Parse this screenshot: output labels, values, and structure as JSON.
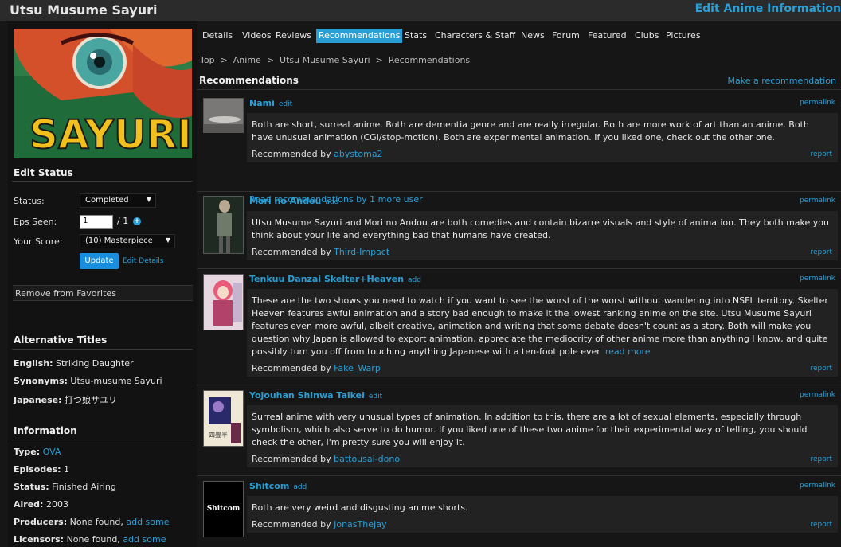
{
  "header": {
    "title": "Utsu Musume Sayuri",
    "edit_info": "Edit Anime Information"
  },
  "sidebar": {
    "poster_text": "SAYURI",
    "edit_status_heading": "Edit Status",
    "status_label": "Status:",
    "status_value": "Completed",
    "eps_label": "Eps Seen:",
    "eps_value": "1",
    "eps_total": "/ 1",
    "score_label": "Your Score:",
    "score_value": "(10) Masterpiece",
    "update_label": "Update",
    "edit_details_label": "Edit Details",
    "remove_favorites": "Remove from Favorites",
    "alt_titles_heading": "Alternative Titles",
    "english_label": "English:",
    "english_value": "Striking Daughter",
    "synonyms_label": "Synonyms:",
    "synonyms_value": "Utsu-musume Sayuri",
    "japanese_label": "Japanese:",
    "japanese_value": "打つ娘サユリ",
    "information_heading": "Information",
    "type_label": "Type:",
    "type_value": "OVA",
    "episodes_label": "Episodes:",
    "episodes_value": "1",
    "status2_label": "Status:",
    "status2_value": "Finished Airing",
    "aired_label": "Aired:",
    "aired_value": "2003",
    "producers_label": "Producers:",
    "producers_value": "None found,",
    "producers_add": "add some",
    "licensors_label": "Licensors:",
    "licensors_value": "None found,",
    "licensors_add": "add some"
  },
  "tabs": [
    "Details",
    "Videos",
    "Reviews",
    "Recommendations",
    "Stats",
    "Characters & Staff",
    "News",
    "Forum",
    "Featured",
    "Clubs",
    "Pictures"
  ],
  "active_tab": "Recommendations",
  "breadcrumb": [
    "Top",
    "Anime",
    "Utsu Musume Sayuri",
    "Recommendations"
  ],
  "breadcrumb_sep": ">",
  "recommendations_heading": "Recommendations",
  "make_recommendation": "Make a recommendation",
  "permalink_label": "permalink",
  "report_label": "report",
  "recommended_by_label": "Recommended by",
  "read_more_users": "Read recommendations by 1 more user",
  "recs": [
    {
      "title": "Nami",
      "action": "edit",
      "text": "Both are short, surreal anime. Both are dementia genre and are really irregular. Both are more work of art than an anime. Both have unusual animation (CGI/stop-motion). Both are experimental animation. If you liked one, check out the other one.",
      "user": "abystoma2"
    },
    {
      "title": "Mori no Andou",
      "action": "add",
      "text": "Utsu Musume Sayuri and Mori no Andou are both comedies and contain bizarre visuals and style of animation. They both make you think about your life and everything bad that humans have created.",
      "user": "Third-Impact"
    },
    {
      "title": "Tenkuu Danzai Skelter+Heaven",
      "action": "add",
      "text": "These are the two shows you need to watch if you want to see the worst of the worst without wandering into NSFL territory. Skelter Heaven features awful animation and a story bad enough to make it the lowest ranking anime on the site. Utsu Musume Sayuri features even more awful, albeit creative, animation and writing that some debate doesn't count as a story. Both will make you question why Japan is allowed to export animation, appreciate the mediocrity of other anime more than anything I know, and quite possibly turn you off from touching anything Japanese with a ten-foot pole ever",
      "more": "read more",
      "user": "Fake_Warp"
    },
    {
      "title": "Yojouhan Shinwa Taikei",
      "action": "edit",
      "text": "Surreal anime with very unusual types of animation. In addition to this, there are a lot of sexual elements, especially through symbolism, which also serve to do humor. If you liked one of these two anime for their experimental way of telling, you should check the other, I'm pretty sure you will enjoy it.",
      "user": "battousai-dono"
    },
    {
      "title": "Shitcom",
      "action": "add",
      "thumb_text": "Shitcom",
      "text": "Both are very weird and disgusting anime shorts.",
      "user": "JonasTheJay"
    }
  ],
  "colors": {
    "accent": "#2a9fd6",
    "background": "#161616",
    "panel": "#222222",
    "header": "#2b2b2b"
  }
}
